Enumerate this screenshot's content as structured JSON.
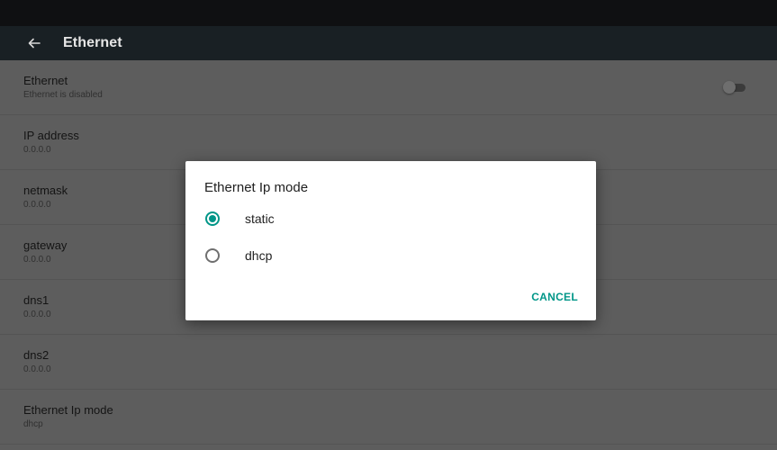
{
  "app_bar": {
    "title": "Ethernet",
    "back_icon": "arrow-back-icon"
  },
  "settings": [
    {
      "title": "Ethernet",
      "summary": "Ethernet is disabled",
      "has_switch": true,
      "switch_on": false
    },
    {
      "title": "IP address",
      "summary": "0.0.0.0"
    },
    {
      "title": "netmask",
      "summary": "0.0.0.0"
    },
    {
      "title": "gateway",
      "summary": "0.0.0.0"
    },
    {
      "title": "dns1",
      "summary": "0.0.0.0"
    },
    {
      "title": "dns2",
      "summary": "0.0.0.0"
    },
    {
      "title": "Ethernet Ip mode",
      "summary": "dhcp"
    }
  ],
  "dialog": {
    "title": "Ethernet Ip mode",
    "options": [
      {
        "label": "static",
        "checked": true
      },
      {
        "label": "dhcp",
        "checked": false
      }
    ],
    "cancel_label": "CANCEL"
  },
  "colors": {
    "accent": "#009688",
    "app_bar": "#192024",
    "status_bar": "#0f1012",
    "dimmed_background": "#5d5d5d"
  }
}
